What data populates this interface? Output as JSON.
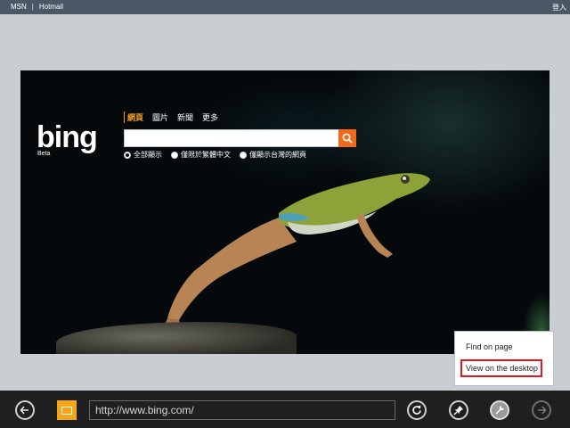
{
  "topbar": {
    "links": [
      "MSN",
      "|",
      "Hotmail"
    ],
    "signin": "登入"
  },
  "bing": {
    "logo": "bing",
    "beta": "Beta",
    "tabs": [
      "網頁",
      "圖片",
      "新聞",
      "更多"
    ],
    "search": {
      "value": ""
    },
    "search_button_icon": "search-icon",
    "radio_options": [
      {
        "label": "全部顯示",
        "selected": true
      },
      {
        "label": "僅限於繁體中文",
        "selected": false
      },
      {
        "label": "僅顯示台灣的網頁",
        "selected": false
      }
    ]
  },
  "context_menu": {
    "items": [
      "Find on page",
      "View on the desktop"
    ],
    "highlight_color": "#e2161c"
  },
  "bottombar": {
    "url": "http://www.bing.com/",
    "favicon_color": "#f4a51a",
    "buttons": [
      "back-icon",
      "refresh-icon",
      "pin-icon",
      "tools-icon",
      "forward-icon"
    ]
  }
}
